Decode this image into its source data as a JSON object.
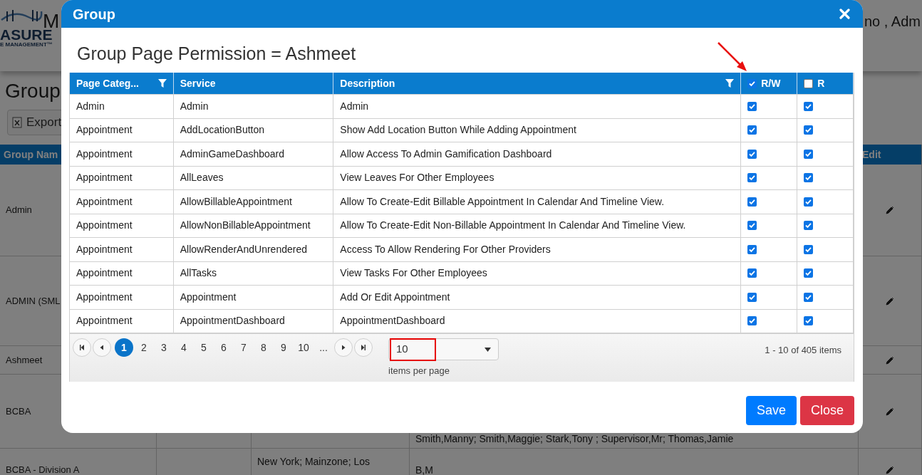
{
  "background_page": {
    "logo_text": "ASURE",
    "logo_tagline": "E MANAGEMENT™",
    "header_title": "M",
    "user_text": "no , Adm",
    "page_title": "Group",
    "export_button": "Export",
    "table": {
      "columns": [
        {
          "label": "Group Nam"
        },
        {
          "label": "Edit"
        }
      ],
      "rows": [
        {
          "name": "Admin"
        },
        {
          "name": "ADMIN (SML"
        },
        {
          "name": "Ashmeet"
        },
        {
          "name": "BCBA",
          "column_4": "Smith,Manny; Smith,Maggie; Stark,Tony ; Supervisor,Mr; Thomas,Jamie"
        },
        {
          "name": "BCBA - Division A",
          "column_3": "New York; Mainzone; Los",
          "column_4": "B,M"
        }
      ]
    }
  },
  "dialog": {
    "title": "Group",
    "heading": "Group Page Permission = Ashmeet",
    "grid": {
      "columns": [
        {
          "label": "Page Categ...",
          "kind": "text",
          "filter": true
        },
        {
          "label": "Service",
          "kind": "text",
          "filter": false
        },
        {
          "label": "Description",
          "kind": "text",
          "filter": true
        },
        {
          "label": "R/W",
          "kind": "checkbox",
          "checked": true
        },
        {
          "label": "R",
          "kind": "checkbox",
          "checked": false
        }
      ],
      "rows": [
        {
          "category": "Admin",
          "service": "Admin",
          "description": "Admin",
          "rw": true,
          "r": true
        },
        {
          "category": "Appointment",
          "service": "AddLocationButton",
          "description": "Show Add Location Button While Adding Appointment",
          "rw": true,
          "r": true
        },
        {
          "category": "Appointment",
          "service": "AdminGameDashboard",
          "description": "Allow Access To Admin Gamification Dashboard",
          "rw": true,
          "r": true
        },
        {
          "category": "Appointment",
          "service": "AllLeaves",
          "description": "View Leaves For Other Employees",
          "rw": true,
          "r": true
        },
        {
          "category": "Appointment",
          "service": "AllowBillableAppointment",
          "description": "Allow To Create-Edit Billable Appointment In Calendar And Timeline View.",
          "rw": true,
          "r": true
        },
        {
          "category": "Appointment",
          "service": "AllowNonBillableAppointment",
          "description": "Allow To Create-Edit Non-Billable Appointment In Calendar And Timeline View.",
          "rw": true,
          "r": true
        },
        {
          "category": "Appointment",
          "service": "AllowRenderAndUnrendered",
          "description": "Access To Allow Rendering For Other Providers",
          "rw": true,
          "r": true
        },
        {
          "category": "Appointment",
          "service": "AllTasks",
          "description": "View Tasks For Other Employees",
          "rw": true,
          "r": true
        },
        {
          "category": "Appointment",
          "service": "Appointment",
          "description": "Add Or Edit Appointment",
          "rw": true,
          "r": true
        },
        {
          "category": "Appointment",
          "service": "AppointmentDashboard",
          "description": "AppointmentDashboard",
          "rw": true,
          "r": true
        }
      ],
      "pager": {
        "pages": [
          {
            "label": "1",
            "selected": true
          },
          {
            "label": "2",
            "selected": false
          },
          {
            "label": "3",
            "selected": false
          },
          {
            "label": "4",
            "selected": false
          },
          {
            "label": "5",
            "selected": false
          },
          {
            "label": "6",
            "selected": false
          },
          {
            "label": "7",
            "selected": false
          },
          {
            "label": "8",
            "selected": false
          },
          {
            "label": "9",
            "selected": false
          },
          {
            "label": "10",
            "selected": false
          },
          {
            "label": "...",
            "selected": false
          }
        ],
        "page_size": "10",
        "page_size_label": "items per page",
        "range": "1 - 10 of 405 items"
      }
    },
    "buttons": [
      {
        "label": "Save",
        "kind": "primary"
      },
      {
        "label": "Close",
        "kind": "danger"
      }
    ]
  }
}
